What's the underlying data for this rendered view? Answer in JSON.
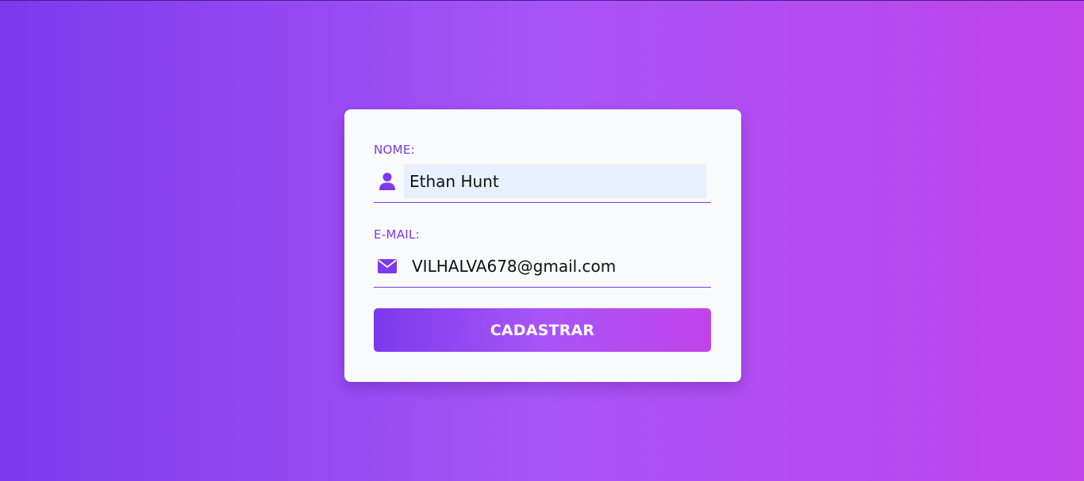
{
  "form": {
    "name_field": {
      "label": "NOME:",
      "value": "Ethan Hunt",
      "icon": "user-icon"
    },
    "email_field": {
      "label": "E-MAIL:",
      "value": "VILHALVA678@gmail.com",
      "icon": "envelope-icon"
    },
    "submit_label": "CADASTRAR"
  },
  "colors": {
    "accent": "#7c3aed",
    "gradient_start": "#7c3aed",
    "gradient_mid": "#a855f7",
    "gradient_end": "#c044ea",
    "card_bg": "#f8fafc",
    "autofill_bg": "#e8f0fe"
  }
}
